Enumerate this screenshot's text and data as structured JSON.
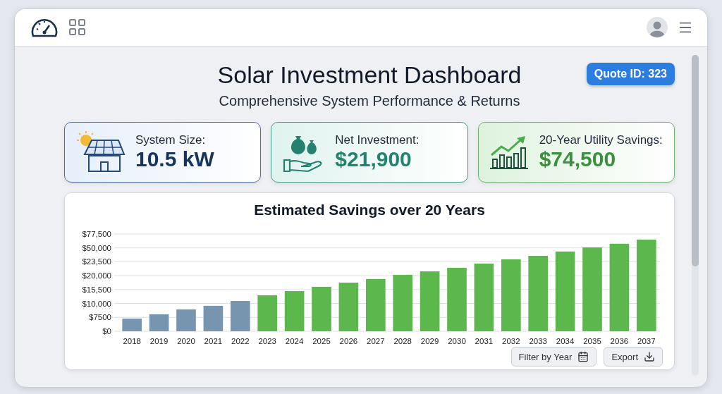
{
  "title": "Solar Investment Dashboard",
  "subtitle": "Comprehensive System Performance & Returns",
  "quote_badge": "Quote ID: 323",
  "stats": [
    {
      "kind": "solar",
      "label": "System Size:",
      "value": "10.5 kW"
    },
    {
      "kind": "money",
      "label": "Net Investment:",
      "value": "$21,900"
    },
    {
      "kind": "growth",
      "label": "20-Year Utility Savings:",
      "value": "$74,500"
    }
  ],
  "chart": {
    "title": "Estimated Savings over 20 Years",
    "y_labels": [
      "$77,500",
      "$50,000",
      "$23,500",
      "$20,000",
      "$15,500",
      "$10,000",
      "$7500",
      "$0"
    ],
    "years": [
      {
        "label": "2018",
        "kind": "past"
      },
      {
        "label": "2019",
        "kind": "past"
      },
      {
        "label": "2020",
        "kind": "past"
      },
      {
        "label": "2021",
        "kind": "past"
      },
      {
        "label": "2022",
        "kind": "past"
      },
      {
        "label": "2023",
        "kind": "projected"
      },
      {
        "label": "2024",
        "kind": "projected"
      },
      {
        "label": "2025",
        "kind": "projected"
      },
      {
        "label": "2026",
        "kind": "projected"
      },
      {
        "label": "2027",
        "kind": "projected"
      },
      {
        "label": "2028",
        "kind": "projected"
      },
      {
        "label": "2029",
        "kind": "projected"
      },
      {
        "label": "2030",
        "kind": "projected"
      },
      {
        "label": "2031",
        "kind": "projected"
      },
      {
        "label": "2032",
        "kind": "projected"
      },
      {
        "label": "2033",
        "kind": "projected"
      },
      {
        "label": "2034",
        "kind": "projected"
      },
      {
        "label": "2035",
        "kind": "projected"
      },
      {
        "label": "2036",
        "kind": "projected"
      },
      {
        "label": "2037",
        "kind": "projected"
      }
    ],
    "buttons": [
      {
        "kind": "filter",
        "label": "Filter by Year"
      },
      {
        "kind": "export",
        "label": "Export"
      }
    ]
  }
}
